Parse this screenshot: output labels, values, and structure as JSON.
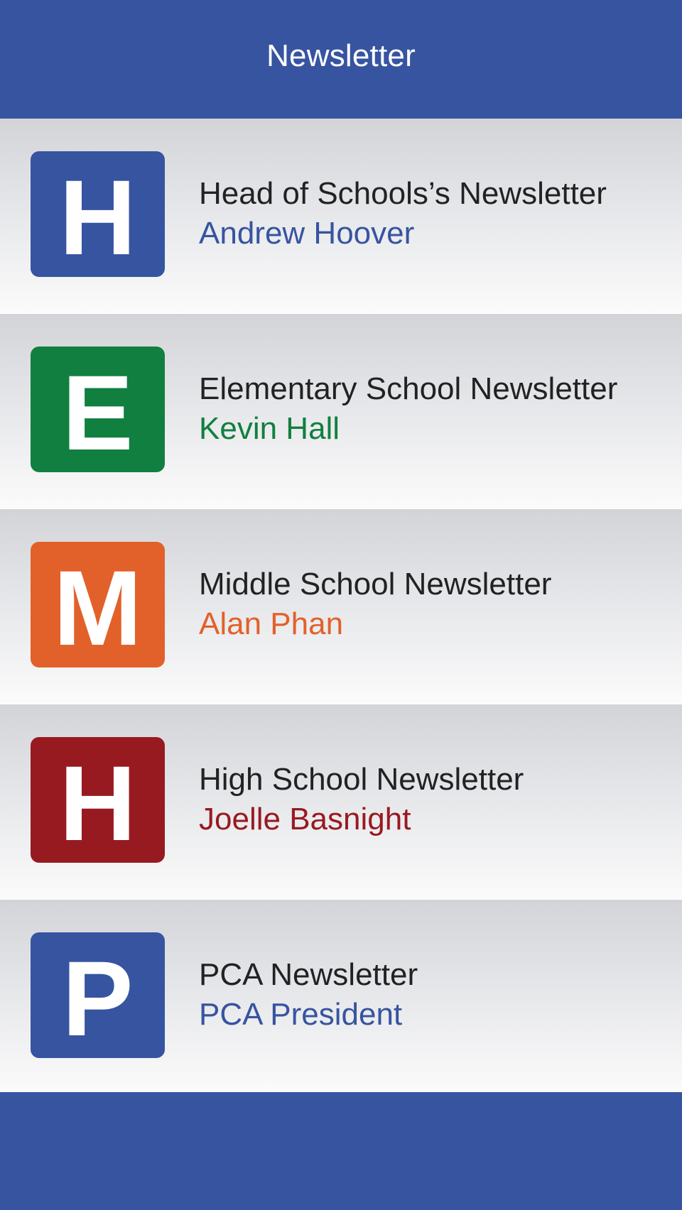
{
  "header": {
    "title": "Newsletter"
  },
  "newsletters": [
    {
      "letter": "H",
      "title": "Head of Schools’s Newsletter",
      "author": "Andrew Hoover",
      "color": "#3754a0",
      "icon": "letter-h-badge"
    },
    {
      "letter": "E",
      "title": "Elementary School Newsletter",
      "author": "Kevin Hall",
      "color": "#117f40",
      "icon": "letter-e-badge"
    },
    {
      "letter": "M",
      "title": "Middle School Newsletter",
      "author": "Alan Phan",
      "color": "#e2612a",
      "icon": "letter-m-badge"
    },
    {
      "letter": "H",
      "title": "High School Newsletter",
      "author": "Joelle Basnight",
      "color": "#981a21",
      "icon": "letter-h-badge"
    },
    {
      "letter": "P",
      "title": "PCA Newsletter",
      "author": "PCA President",
      "color": "#3754a0",
      "icon": "letter-p-badge"
    }
  ],
  "colors": {
    "brand": "#3754a0",
    "title_text": "#222222",
    "header_text": "#ffffff"
  }
}
